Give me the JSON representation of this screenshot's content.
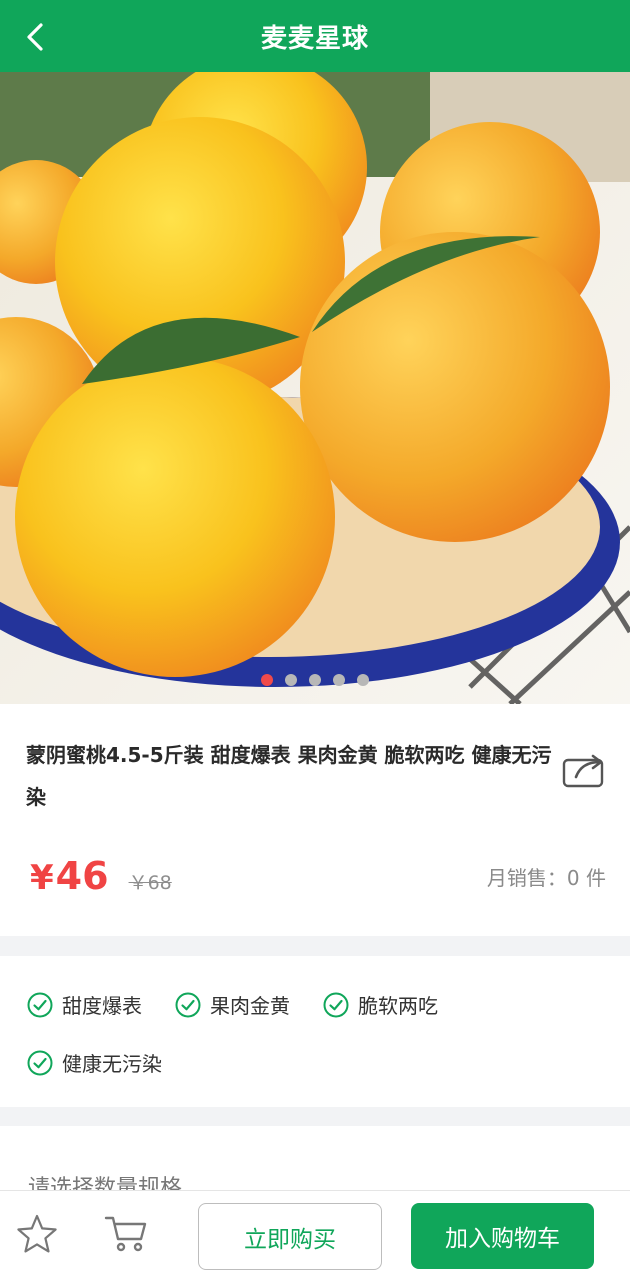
{
  "header": {
    "title": "麦麦星球"
  },
  "gallery": {
    "image_count": 5,
    "active_index": 0
  },
  "product": {
    "title": "蒙阴蜜桃4.5-5斤装 甜度爆表 果肉金黄 脆软两吃 健康无污染",
    "price_symbol": "¥",
    "price": "46",
    "original_price": "￥68",
    "monthly_sales": "月销售：0 件"
  },
  "features": [
    "甜度爆表",
    "果肉金黄",
    "脆软两吃",
    "健康无污染"
  ],
  "spec": {
    "label": "请选择数量规格"
  },
  "actions": {
    "favorite_icon": "star-icon",
    "cart_icon": "cart-icon",
    "buy_now": "立即购买",
    "add_to_cart": "加入购物车"
  },
  "colors": {
    "brand": "#10a65a",
    "price": "#f04444"
  }
}
